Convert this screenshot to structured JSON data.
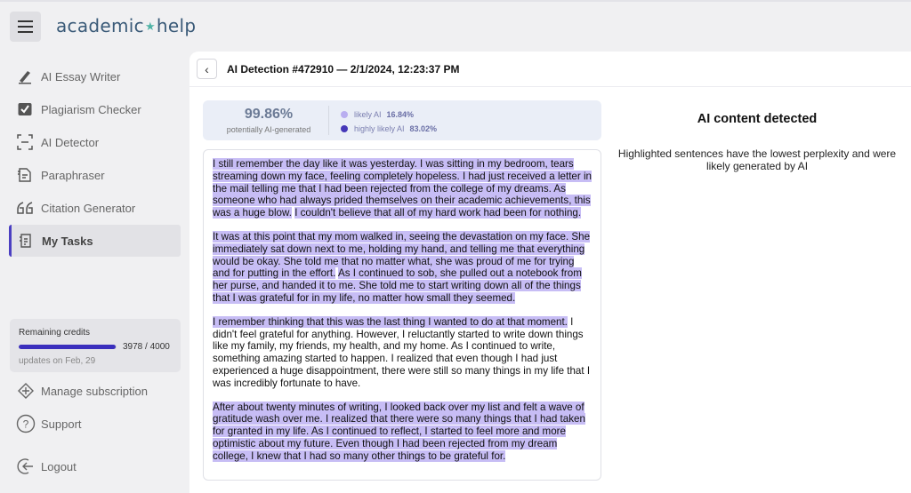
{
  "header": {
    "logo_left": "academic",
    "logo_star": "★",
    "logo_right": "help"
  },
  "sidebar": {
    "items": [
      {
        "label": "AI Essay Writer",
        "icon": "pen-icon"
      },
      {
        "label": "Plagiarism Checker",
        "icon": "check-square-icon"
      },
      {
        "label": "AI Detector",
        "icon": "scan-icon"
      },
      {
        "label": "Paraphraser",
        "icon": "document-edit-icon"
      },
      {
        "label": "Citation Generator",
        "icon": "quote-icon"
      },
      {
        "label": "My Tasks",
        "icon": "tasks-icon",
        "active": true
      }
    ],
    "credits": {
      "title": "Remaining credits",
      "count": "3978 / 4000",
      "progress": 0.9945,
      "updates": "updates on Feb, 29"
    },
    "manage_subscription": "Manage subscription",
    "support": "Support",
    "logout": "Logout"
  },
  "main": {
    "title": "AI Detection #472910 — 2/1/2024, 12:23:37 PM",
    "score": "99.86%",
    "score_label": "potentially AI-generated",
    "legend": [
      {
        "label": "likely AI",
        "value": "16.84%",
        "color": "#b9aef0"
      },
      {
        "label": "highly likely AI",
        "value": "83.02%",
        "color": "#4638b8"
      }
    ],
    "paragraphs": [
      [
        {
          "t": "I still remember the day like it was yesterday. I was sitting in my bedroom, tears streaming down my face, feeling completely hopeless. I had just received a letter in the mail telling me that I had been rejected from the college of my dreams. As someone who had always prided themselves on their academic achievements, this was a huge blow.",
          "h": true
        },
        {
          "t": " ",
          "h": false
        },
        {
          "t": "I couldn't believe that all of my hard work had been for nothing.",
          "h": true
        }
      ],
      [
        {
          "t": "It was at this point that my mom walked in, seeing the devastation on my face. She immediately sat down next to me, holding my hand, and telling me that everything would be okay. She told me that no matter what, she was proud of me for trying and for putting in the effort.",
          "h": true
        },
        {
          "t": " ",
          "h": false
        },
        {
          "t": "As I continued to sob, she pulled out a notebook from her purse, and handed it to me. She told me to start writing down all of the things that I was grateful for in my life, no matter how small they seemed.",
          "h": true
        }
      ],
      [
        {
          "t": "I remember thinking that this was the last thing I wanted to do at that moment.",
          "h": true
        },
        {
          "t": " I didn't feel grateful for anything. However, I reluctantly started to write down things like my family, my friends, my health, and my home. As I continued to write, something amazing started to happen. I realized that even though I had just experienced a huge disappointment, there were still so many things in my life that I was incredibly fortunate to have.",
          "h": false
        }
      ],
      [
        {
          "t": "After about twenty minutes of writing, I looked back over my list and felt a wave of gratitude wash over me. I realized that there were so many things that I had taken for granted in my life. As I continued to reflect, I started to feel more and more optimistic about my future. Even though I had been rejected from my dream college, I knew that I had so many other things to be grateful for.",
          "h": true
        }
      ]
    ],
    "result_title": "AI content detected",
    "result_text": "Highlighted sentences have the lowest perplexity and were likely generated by AI"
  }
}
